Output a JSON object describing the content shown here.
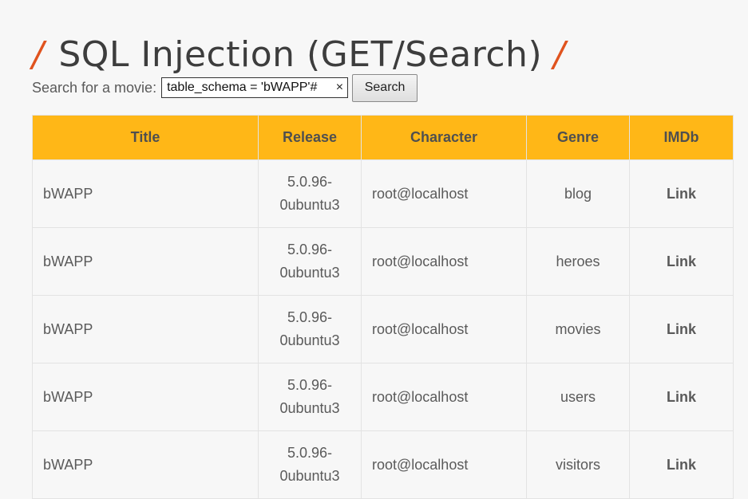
{
  "page": {
    "title": "SQL Injection (GET/Search)",
    "slash": "/"
  },
  "search": {
    "label": "Search for a movie:",
    "value": "table_schema = 'bWAPP'#",
    "clear_icon": "×",
    "button_label": "Search"
  },
  "table": {
    "headers": [
      "Title",
      "Release",
      "Character",
      "Genre",
      "IMDb"
    ],
    "rows": [
      {
        "title": "bWAPP",
        "release": "5.0.96-0ubuntu3",
        "character": "root@localhost",
        "genre": "blog",
        "imdb": "Link"
      },
      {
        "title": "bWAPP",
        "release": "5.0.96-0ubuntu3",
        "character": "root@localhost",
        "genre": "heroes",
        "imdb": "Link"
      },
      {
        "title": "bWAPP",
        "release": "5.0.96-0ubuntu3",
        "character": "root@localhost",
        "genre": "movies",
        "imdb": "Link"
      },
      {
        "title": "bWAPP",
        "release": "5.0.96-0ubuntu3",
        "character": "root@localhost",
        "genre": "users",
        "imdb": "Link"
      },
      {
        "title": "bWAPP",
        "release": "5.0.96-0ubuntu3",
        "character": "root@localhost",
        "genre": "visitors",
        "imdb": "Link"
      }
    ]
  },
  "colors": {
    "header_bg": "#ffb717",
    "accent_slash": "#e0531e",
    "page_bg": "#f7f7f7"
  }
}
